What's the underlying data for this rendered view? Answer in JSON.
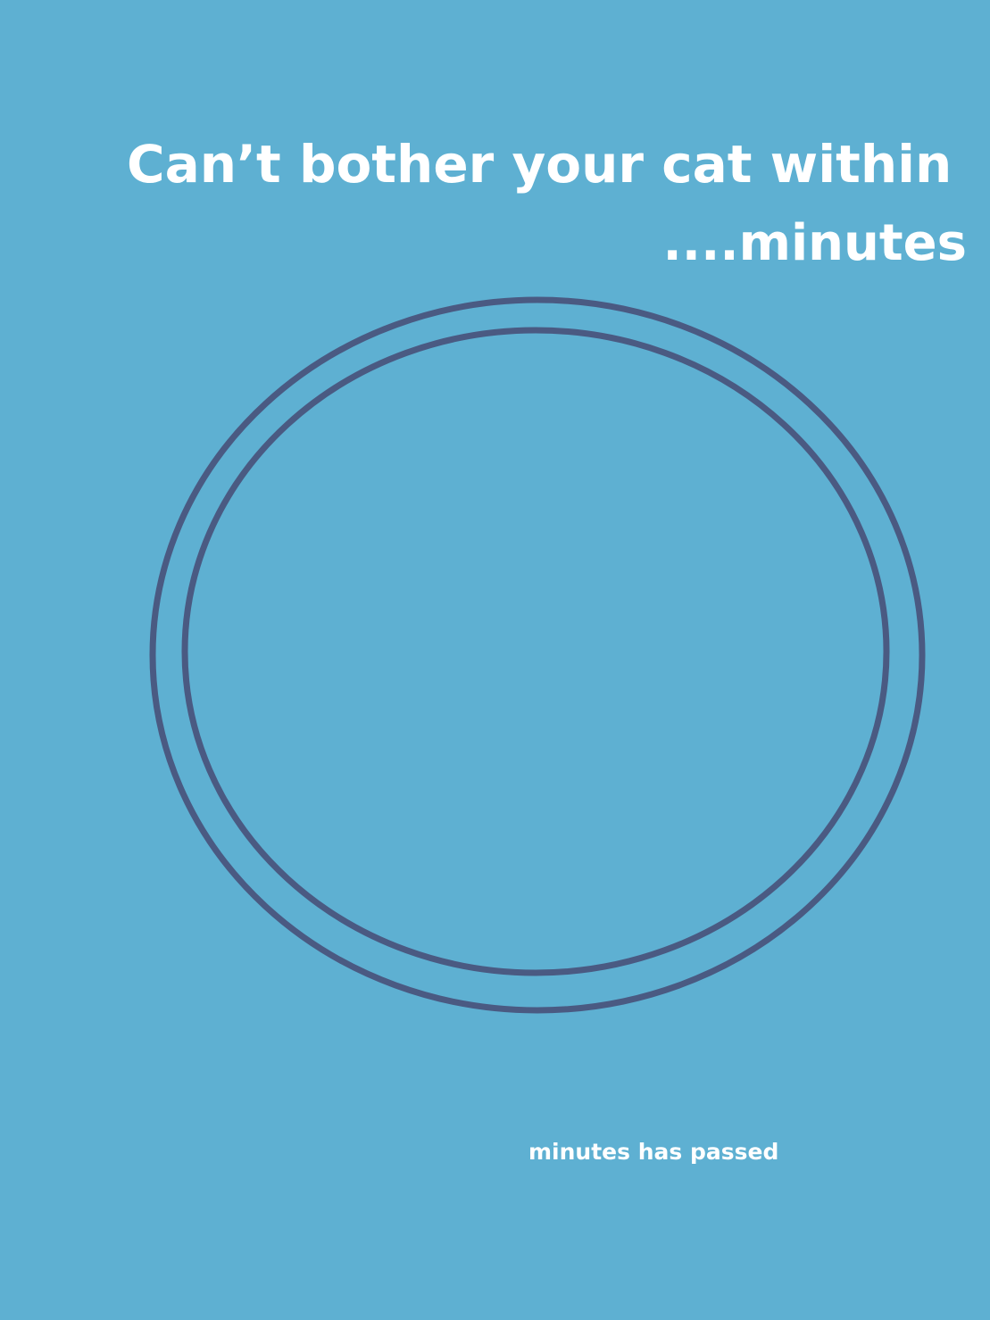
{
  "title": {
    "line1": "Can’t bother your cat within",
    "line2": "....minutes"
  },
  "status": {
    "label": "minutes has passed"
  },
  "colors": {
    "background": "#5eb0d2",
    "text": "#ffffff",
    "ring": "#4a5a82"
  }
}
